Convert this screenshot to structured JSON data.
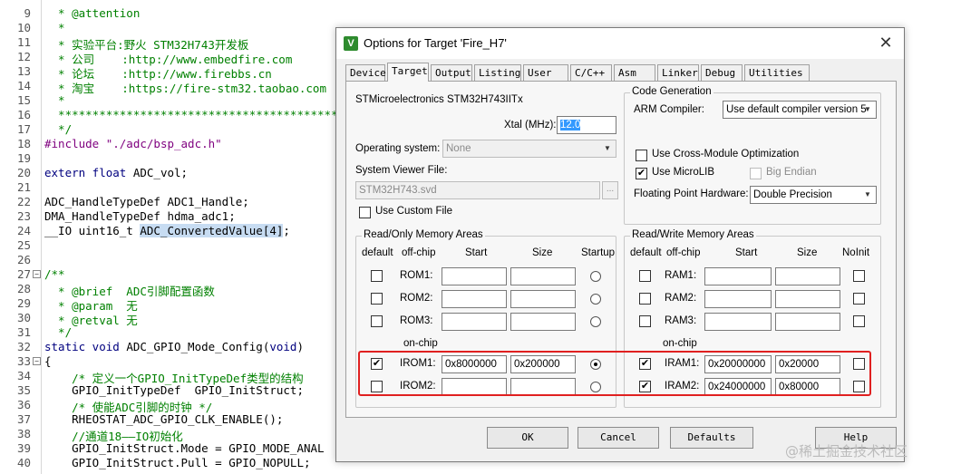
{
  "editor": {
    "lines": [
      {
        "num": "9",
        "segments": [
          {
            "t": "  * @attention",
            "c": "c-green"
          }
        ]
      },
      {
        "num": "10",
        "segments": [
          {
            "t": "  *",
            "c": "c-green"
          }
        ]
      },
      {
        "num": "11",
        "segments": [
          {
            "t": "  * 实验平台:野火 STM32H743开发板",
            "c": "c-green"
          }
        ]
      },
      {
        "num": "12",
        "segments": [
          {
            "t": "  * 公司    :http://www.embedfire.com",
            "c": "c-green"
          }
        ]
      },
      {
        "num": "13",
        "segments": [
          {
            "t": "  * 论坛    :http://www.firebbs.cn",
            "c": "c-green"
          }
        ]
      },
      {
        "num": "14",
        "segments": [
          {
            "t": "  * 淘宝    :https://fire-stm32.taobao.com",
            "c": "c-green"
          }
        ]
      },
      {
        "num": "15",
        "segments": [
          {
            "t": "  *",
            "c": "c-green"
          }
        ]
      },
      {
        "num": "16",
        "segments": [
          {
            "t": "  ******************************************",
            "c": "c-green"
          }
        ]
      },
      {
        "num": "17",
        "segments": [
          {
            "t": "  */",
            "c": "c-green"
          }
        ]
      },
      {
        "num": "18",
        "segments": [
          {
            "t": "#include ",
            "c": "c-purple"
          },
          {
            "t": "\"./adc/bsp_adc.h\"",
            "c": "c-purple"
          }
        ]
      },
      {
        "num": "19",
        "segments": []
      },
      {
        "num": "20",
        "segments": [
          {
            "t": "extern float ",
            "c": "c-blue"
          },
          {
            "t": "ADC_vol;",
            "c": "c-black"
          }
        ]
      },
      {
        "num": "21",
        "segments": []
      },
      {
        "num": "22",
        "segments": [
          {
            "t": "ADC_HandleTypeDef ADC1_Handle;",
            "c": "c-black"
          }
        ]
      },
      {
        "num": "23",
        "segments": [
          {
            "t": "DMA_HandleTypeDef hdma_adc1;",
            "c": "c-black"
          }
        ]
      },
      {
        "num": "24",
        "segments": [
          {
            "t": "__IO uint16_t ",
            "c": "c-black"
          },
          {
            "t": "ADC_ConvertedValue[4]",
            "c": "c-black hl"
          },
          {
            "t": ";",
            "c": "c-black"
          }
        ]
      },
      {
        "num": "25",
        "segments": []
      },
      {
        "num": "26",
        "segments": []
      },
      {
        "num": "27",
        "segments": [
          {
            "t": "/**",
            "c": "c-green"
          }
        ]
      },
      {
        "num": "28",
        "segments": [
          {
            "t": "  * @brief  ADC引脚配置函数",
            "c": "c-green"
          }
        ]
      },
      {
        "num": "29",
        "segments": [
          {
            "t": "  * @param  无",
            "c": "c-green"
          }
        ]
      },
      {
        "num": "30",
        "segments": [
          {
            "t": "  * @retval 无",
            "c": "c-green"
          }
        ]
      },
      {
        "num": "31",
        "segments": [
          {
            "t": "  */",
            "c": "c-green"
          }
        ]
      },
      {
        "num": "32",
        "segments": [
          {
            "t": "static void ",
            "c": "c-blue"
          },
          {
            "t": "ADC_GPIO_Mode_Config(",
            "c": "c-black"
          },
          {
            "t": "void",
            "c": "c-blue"
          },
          {
            "t": ")",
            "c": "c-black"
          }
        ]
      },
      {
        "num": "33",
        "segments": [
          {
            "t": "{",
            "c": "c-black"
          }
        ]
      },
      {
        "num": "34",
        "segments": [
          {
            "t": "    /* 定义一个GPIO_InitTypeDef类型的结构",
            "c": "c-green"
          }
        ]
      },
      {
        "num": "35",
        "segments": [
          {
            "t": "    GPIO_InitTypeDef  GPIO_InitStruct;",
            "c": "c-black"
          }
        ]
      },
      {
        "num": "36",
        "segments": [
          {
            "t": "    /* 使能ADC引脚的时钟 */",
            "c": "c-green"
          }
        ]
      },
      {
        "num": "37",
        "segments": [
          {
            "t": "    RHEOSTAT_ADC_GPIO_CLK_ENABLE();",
            "c": "c-black"
          }
        ]
      },
      {
        "num": "38",
        "segments": [
          {
            "t": "    //通道18——IO初始化",
            "c": "c-green"
          }
        ]
      },
      {
        "num": "39",
        "segments": [
          {
            "t": "    GPIO_InitStruct.Mode = GPIO_MODE_ANAL",
            "c": "c-black"
          }
        ]
      },
      {
        "num": "40",
        "segments": [
          {
            "t": "    GPIO_InitStruct.Pull = GPIO_NOPULL;",
            "c": "c-black"
          }
        ]
      }
    ]
  },
  "dialog": {
    "title": "Options for Target 'Fire_H7'",
    "icon": "keil-uv-icon",
    "close": "✕",
    "tabs": [
      "Device",
      "Target",
      "Output",
      "Listing",
      "User",
      "C/C++",
      "Asm",
      "Linker",
      "Debug",
      "Utilities"
    ],
    "active_tab": "Target",
    "device_name": "STMicroelectronics STM32H743IITx",
    "xtal_label": "Xtal (MHz):",
    "xtal_value": "12.0",
    "os_label": "Operating system:",
    "os_value": "None",
    "svd_label": "System Viewer File:",
    "svd_value": "STM32H743.svd",
    "svd_browse": "...",
    "custom_file_label": "Use Custom File",
    "codegen": {
      "title": "Code Generation",
      "compiler_label": "ARM Compiler:",
      "compiler_value": "Use default compiler version 5",
      "cross_module_label": "Use Cross-Module Optimization",
      "cross_module_checked": false,
      "microlib_label": "Use MicroLIB",
      "microlib_checked": true,
      "big_endian_label": "Big Endian",
      "fpu_label": "Floating Point Hardware:",
      "fpu_value": "Double Precision"
    },
    "rom": {
      "title": "Read/Only Memory Areas",
      "headers": {
        "default": "default",
        "offchip": "off-chip",
        "start": "Start",
        "size": "Size",
        "startup": "Startup"
      },
      "onchip_label": "on-chip",
      "rows": [
        {
          "name": "ROM1:",
          "default": false,
          "start": "",
          "size": "",
          "startup": false
        },
        {
          "name": "ROM2:",
          "default": false,
          "start": "",
          "size": "",
          "startup": false
        },
        {
          "name": "ROM3:",
          "default": false,
          "start": "",
          "size": "",
          "startup": false
        },
        {
          "name": "IROM1:",
          "default": true,
          "start": "0x8000000",
          "size": "0x200000",
          "startup": true
        },
        {
          "name": "IROM2:",
          "default": false,
          "start": "",
          "size": "",
          "startup": false
        }
      ]
    },
    "ram": {
      "title": "Read/Write Memory Areas",
      "headers": {
        "default": "default",
        "offchip": "off-chip",
        "start": "Start",
        "size": "Size",
        "noinit": "NoInit"
      },
      "onchip_label": "on-chip",
      "rows": [
        {
          "name": "RAM1:",
          "default": false,
          "start": "",
          "size": "",
          "noinit": false
        },
        {
          "name": "RAM2:",
          "default": false,
          "start": "",
          "size": "",
          "noinit": false
        },
        {
          "name": "RAM3:",
          "default": false,
          "start": "",
          "size": "",
          "noinit": false
        },
        {
          "name": "IRAM1:",
          "default": true,
          "start": "0x20000000",
          "size": "0x20000",
          "noinit": false
        },
        {
          "name": "IRAM2:",
          "default": true,
          "start": "0x24000000",
          "size": "0x80000",
          "noinit": false
        }
      ]
    },
    "buttons": {
      "ok": "OK",
      "cancel": "Cancel",
      "defaults": "Defaults",
      "help": "Help"
    }
  },
  "watermark": "@稀土掘金技术社区",
  "colors": {
    "highlight_box": "#e02020",
    "selection": "#3399ff"
  }
}
